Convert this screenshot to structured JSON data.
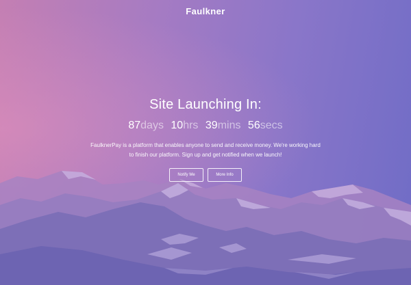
{
  "brand": {
    "name": "Faulkner"
  },
  "hero": {
    "title": "Site Launching In:",
    "countdown": [
      {
        "value": "87",
        "unit": "days"
      },
      {
        "value": "10",
        "unit": "hrs"
      },
      {
        "value": "39",
        "unit": "mins"
      },
      {
        "value": "56",
        "unit": "secs"
      }
    ],
    "description": "FaulknerPay is a platform that enables anyone to send and receive money. We're working hard to finish our platform. Sign up and get notified when we launch!",
    "buttons": {
      "notify_label": "Notify Me",
      "more_info_label": "More Info"
    }
  },
  "colors": {
    "gradient_left": "#c47fb3",
    "gradient_right": "#6f6cc6",
    "text": "#ffffff"
  }
}
